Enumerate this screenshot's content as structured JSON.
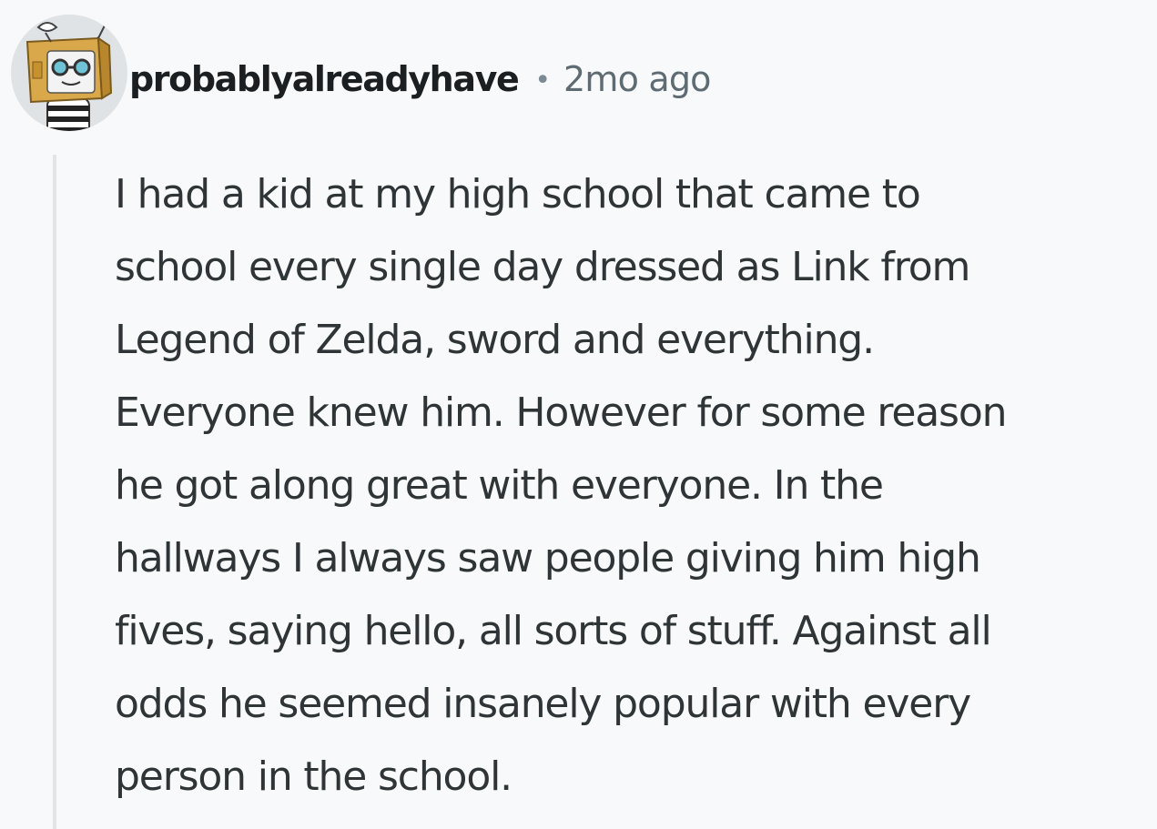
{
  "comment": {
    "author": {
      "username": "probablyalreadyhave",
      "avatar_icon": "box-head-avatar-icon"
    },
    "separator": "•",
    "timestamp": "2mo ago",
    "body_lines": [
      "I had a kid at my high school that came to",
      "school every single day dressed as Link from",
      "Legend of Zelda, sword and everything.",
      "Everyone knew him. However for some reason",
      "he got along great with everyone. In the",
      "hallways I always saw people giving him high",
      "fives, saying hello, all sorts of stuff. Against all",
      "odds he seemed insanely popular with every",
      "person in the school."
    ]
  },
  "colors": {
    "background": "#f7f9fa",
    "text": "#2f3437",
    "username": "#1c1f21",
    "meta": "#5f6b73",
    "thread_line": "#e1e5e8"
  }
}
